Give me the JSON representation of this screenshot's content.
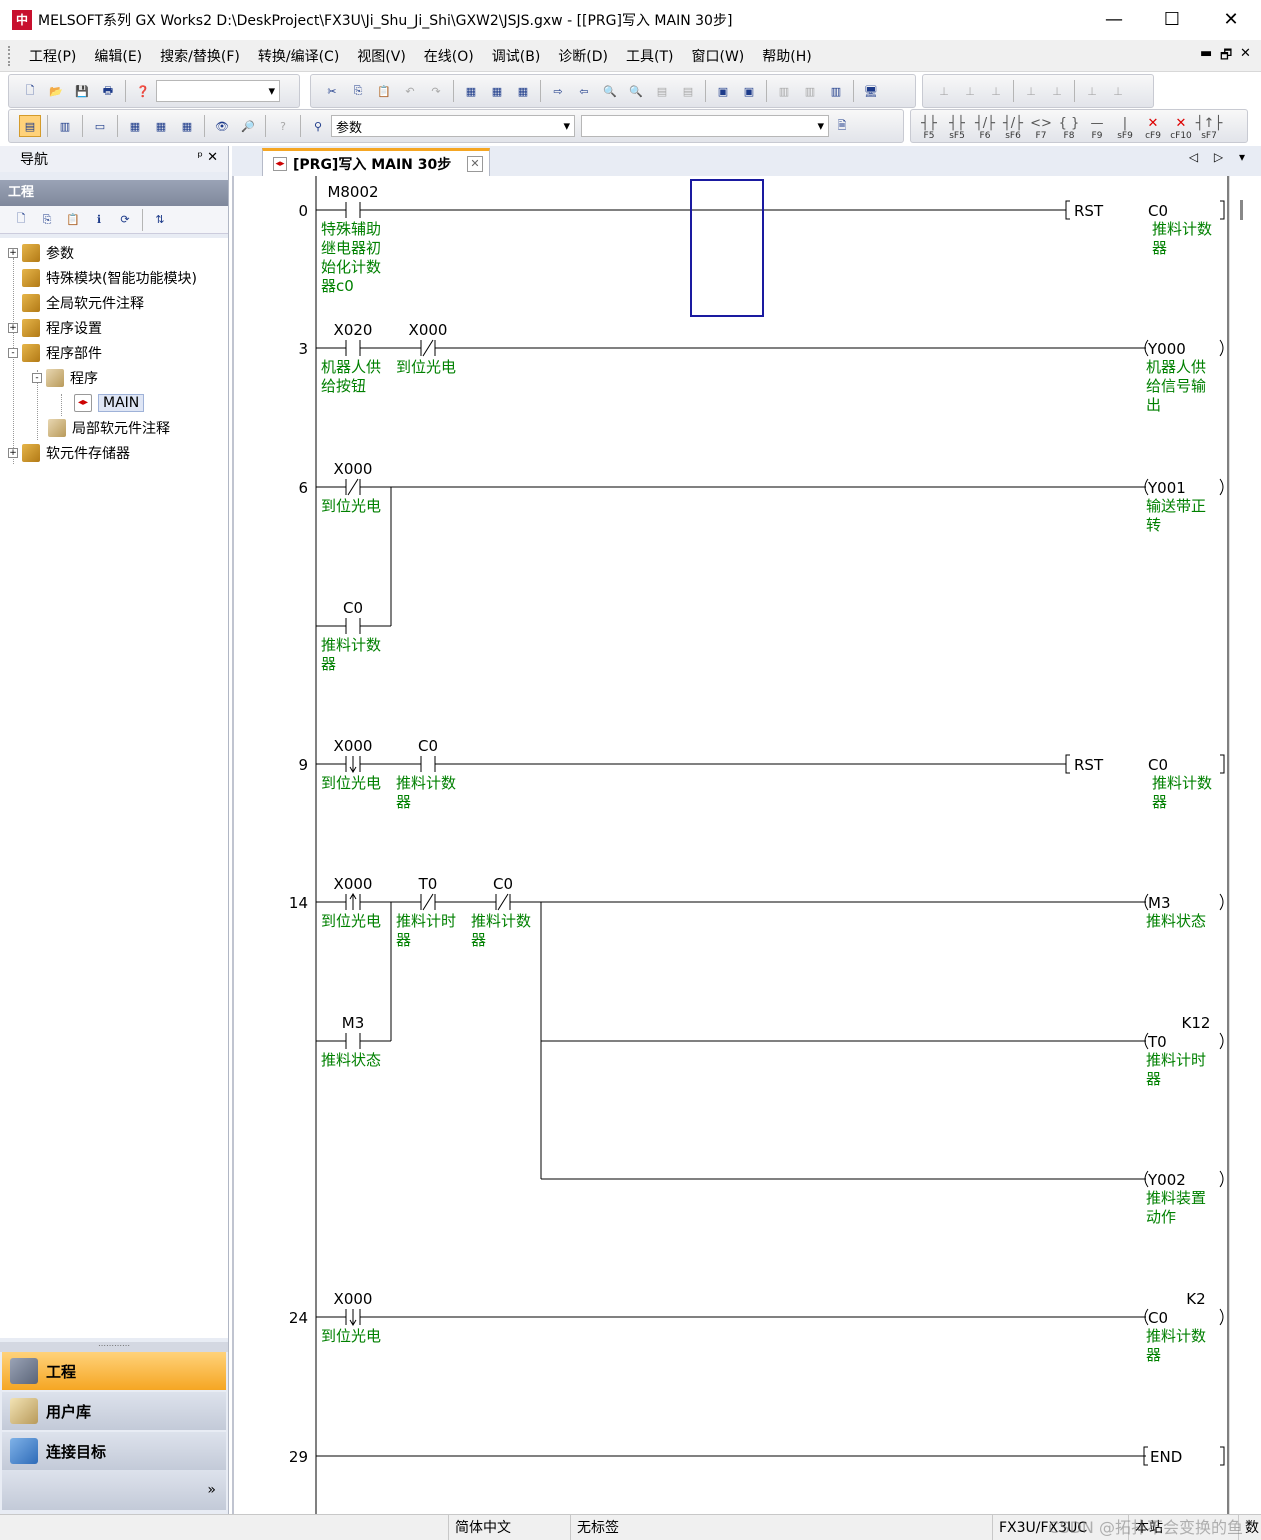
{
  "window": {
    "title": "MELSOFT系列 GX Works2 D:\\DeskProject\\FX3U\\Ji_Shu_Ji_Shi\\GXW2\\JSJS.gxw - [[PRG]写入 MAIN 30步]",
    "app_icon_text": "中",
    "minimize": "—",
    "maximize": "☐",
    "close": "✕"
  },
  "menu": {
    "items": [
      "工程(P)",
      "编辑(E)",
      "搜索/替换(F)",
      "转换/编译(C)",
      "视图(V)",
      "在线(O)",
      "调试(B)",
      "诊断(D)",
      "工具(T)",
      "窗口(W)",
      "帮助(H)"
    ],
    "mdi_buttons": [
      "▬",
      "🗗",
      "✕"
    ]
  },
  "toolbar": {
    "parameter_combo": "参数",
    "fkeys": [
      {
        "sym": "┤├",
        "key": "F5"
      },
      {
        "sym": "┤├",
        "key": "sF5"
      },
      {
        "sym": "┤/├",
        "key": "F6"
      },
      {
        "sym": "┤/├",
        "key": "sF6"
      },
      {
        "sym": "<>",
        "key": "F7"
      },
      {
        "sym": "{ }",
        "key": "F8"
      },
      {
        "sym": "—",
        "key": "F9"
      },
      {
        "sym": "|",
        "key": "sF9"
      },
      {
        "sym": "✕",
        "key": "cF9"
      },
      {
        "sym": "✕",
        "key": "cF10"
      },
      {
        "sym": "┤↑├",
        "key": "sF7"
      }
    ]
  },
  "nav": {
    "header": "导航",
    "pin_icons": "ᵖ ✕",
    "section": "工程",
    "tree": [
      {
        "label": "参数",
        "exp": "+"
      },
      {
        "label": "特殊模块(智能功能模块)",
        "exp": ""
      },
      {
        "label": "全局软元件注释",
        "exp": ""
      },
      {
        "label": "程序设置",
        "exp": "+"
      },
      {
        "label": "程序部件",
        "exp": "-"
      },
      {
        "label": "程序",
        "exp": "-"
      },
      {
        "label": "MAIN",
        "exp": ""
      },
      {
        "label": "局部软元件注释",
        "exp": ""
      },
      {
        "label": "软元件存储器",
        "exp": "+"
      }
    ],
    "tabs": [
      "工程",
      "用户库",
      "连接目标"
    ],
    "more": "»"
  },
  "doc_tab": {
    "label": "[PRG]写入 MAIN 30步",
    "close": "✕",
    "arrows": "◁ ▷ ▾"
  },
  "ladder": {
    "rungs": [
      {
        "step": "0"
      },
      {
        "step": "3"
      },
      {
        "step": "6"
      },
      {
        "step": "9"
      },
      {
        "step": "14"
      },
      {
        "step": "24"
      },
      {
        "step": "29"
      }
    ],
    "contacts": [
      {
        "device": "M8002",
        "comment": [
          "特殊辅助",
          "继电器初",
          "始化计数",
          "器c0"
        ]
      },
      {
        "device": "X020",
        "comment": [
          "机器人供",
          "给按钮"
        ]
      },
      {
        "device": "X000",
        "comment": [
          "到位光电"
        ]
      },
      {
        "device": "X000",
        "comment": [
          "到位光电"
        ]
      },
      {
        "device": "C0",
        "comment": [
          "推料计数",
          "器"
        ]
      },
      {
        "device": "X000",
        "comment": [
          "到位光电"
        ]
      },
      {
        "device": "C0",
        "comment": [
          "推料计数",
          "器"
        ]
      },
      {
        "device": "X000",
        "comment": [
          "到位光电"
        ]
      },
      {
        "device": "T0",
        "comment": [
          "推料计时",
          "器"
        ]
      },
      {
        "device": "C0",
        "comment": [
          "推料计数",
          "器"
        ]
      },
      {
        "device": "M3",
        "comment": [
          "推料状态"
        ]
      },
      {
        "device": "X000",
        "comment": [
          "到位光电"
        ]
      }
    ],
    "outputs": [
      {
        "instr": "RST",
        "device": "C0",
        "comment": [
          "推料计数",
          "器"
        ]
      },
      {
        "instr": "",
        "device": "Y000",
        "comment": [
          "机器人供",
          "给信号输",
          "出"
        ]
      },
      {
        "instr": "",
        "device": "Y001",
        "comment": [
          "输送带正",
          "转"
        ]
      },
      {
        "instr": "RST",
        "device": "C0",
        "comment": [
          "推料计数",
          "器"
        ]
      },
      {
        "instr": "",
        "device": "M3",
        "comment": [
          "推料状态"
        ]
      },
      {
        "instr": "",
        "device": "T0",
        "setval": "K12",
        "comment": [
          "推料计时",
          "器"
        ]
      },
      {
        "instr": "",
        "device": "Y002",
        "comment": [
          "推料装置",
          "动作"
        ]
      },
      {
        "instr": "",
        "device": "C0",
        "setval": "K2",
        "comment": [
          "推料计数",
          "器"
        ]
      },
      {
        "instr": "END",
        "device": "",
        "comment": []
      }
    ]
  },
  "status": {
    "language": "简体中文",
    "label": "无标签",
    "plc": "FX3U/FX3UC",
    "station": "本站",
    "extra": "数",
    "watermark": "CSDN @拓扑不会变换的鱼"
  },
  "colors": {
    "comment": "#008000",
    "cursor": "#1a1aa0",
    "nav_active": "#f5a623"
  }
}
